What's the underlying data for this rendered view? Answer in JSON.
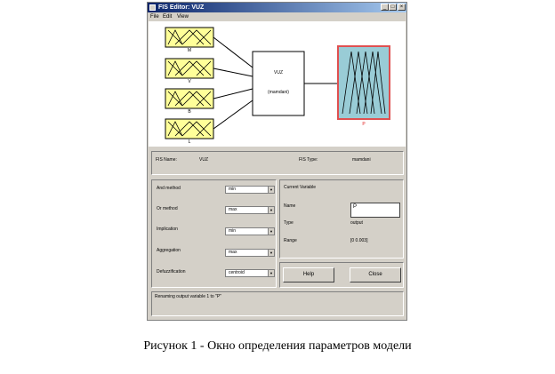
{
  "window": {
    "title": "FIS Editor: VUZ",
    "controls": [
      "_",
      "□",
      "×"
    ],
    "menu": [
      "File",
      "Edit",
      "View"
    ]
  },
  "diagram": {
    "inputs": [
      "M",
      "V",
      "B",
      "L"
    ],
    "system_name": "VUZ",
    "system_type": "(mamdani)",
    "output": "P"
  },
  "info": {
    "fis_name_label": "FIS Name:",
    "fis_name_value": "VUZ",
    "fis_type_label": "FIS Type:",
    "fis_type_value": "mamdani"
  },
  "methods": [
    {
      "label": "And method",
      "value": "min"
    },
    {
      "label": "Or method",
      "value": "max"
    },
    {
      "label": "Implication",
      "value": "min"
    },
    {
      "label": "Aggregation",
      "value": "max"
    },
    {
      "label": "Defuzzification",
      "value": "centroid"
    }
  ],
  "current_variable": {
    "title": "Current Variable",
    "name_label": "Name",
    "name_value": "P",
    "type_label": "Type",
    "type_value": "output",
    "range_label": "Range",
    "range_value": "[0 0.003]"
  },
  "buttons": {
    "help": "Help",
    "close": "Close"
  },
  "status": "Renaming output variable 1 to \"P\"",
  "caption": "Рисунок 1 - Окно определения параметров модели",
  "colors": {
    "input_box": "#ffff99",
    "output_box": "#99ccd6",
    "output_border": "#e05050",
    "output_label": "#e02020"
  }
}
